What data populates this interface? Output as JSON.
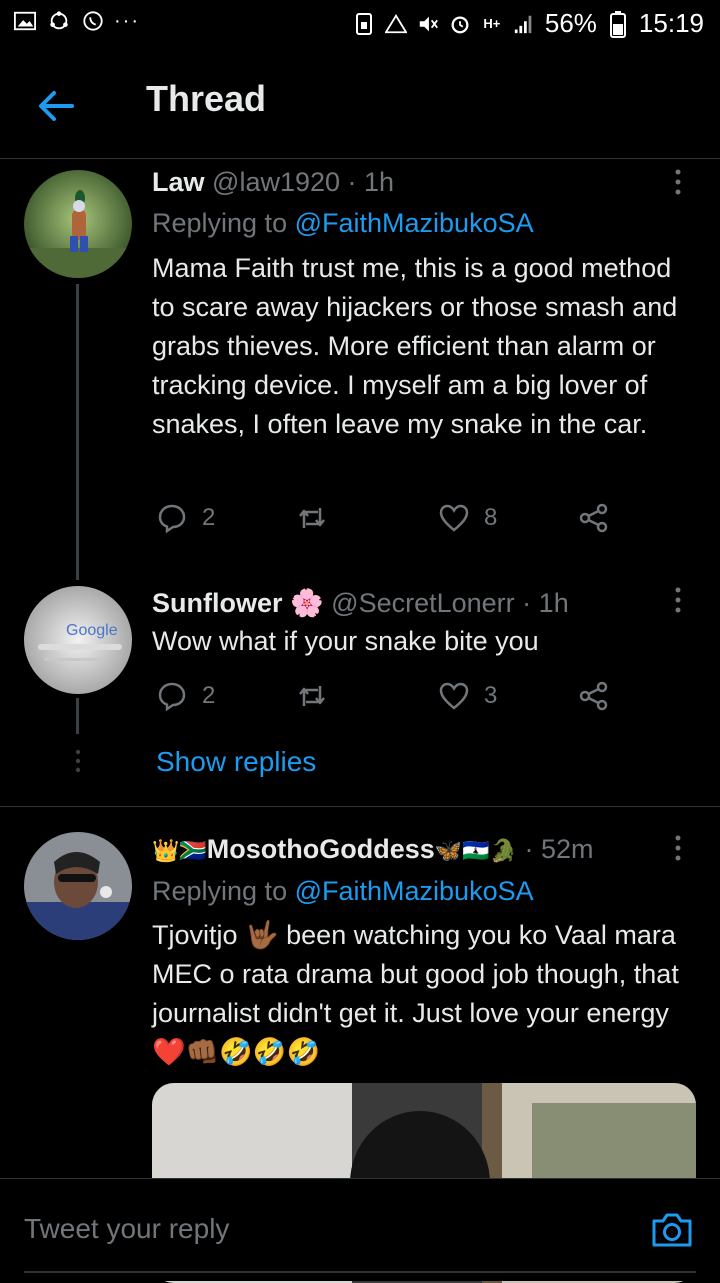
{
  "status_bar": {
    "battery": "56%",
    "time": "15:19",
    "network": "H+"
  },
  "header": {
    "title": "Thread"
  },
  "tweets": [
    {
      "name": "Law",
      "handle": "@law1920",
      "sep": " · ",
      "time": "1h",
      "replying_prefix": "Replying to ",
      "replying_to": "@FaithMazibukoSA",
      "text": "Mama Faith trust me, this is a good method to scare away hijackers or those smash and grabs thieves. More efficient than alarm or tracking device. I myself am a big lover of snakes, I often leave my snake in the car.",
      "replies": "2",
      "retweets": "",
      "likes": "8"
    },
    {
      "name": "Sunflower",
      "name_emoji": "🌸",
      "handle": "@SecretLonerr",
      "sep": " · ",
      "time": "1h",
      "text": "Wow what if your snake bite you",
      "replies": "2",
      "retweets": "",
      "likes": "3",
      "avatar_text": "Google"
    },
    {
      "name_prefix": "👑🇿🇦",
      "name": "MosothoGoddess",
      "name_suffix": "🦋🇱🇸🐊",
      "sep": " · ",
      "time": "52m",
      "replying_prefix": "Replying to ",
      "replying_to": "@FaithMazibukoSA",
      "text": "Tjovitjo 🤟🏾 been watching you ko Vaal mara MEC o rata drama but good job though,  that journalist didn't get it. Just love your energy ❤️👊🏾🤣🤣🤣"
    }
  ],
  "show_replies": "Show replies",
  "composer": {
    "placeholder": "Tweet your reply"
  },
  "colors": {
    "accent": "#1d9bf0",
    "background": "#000000",
    "muted": "#71767b"
  }
}
